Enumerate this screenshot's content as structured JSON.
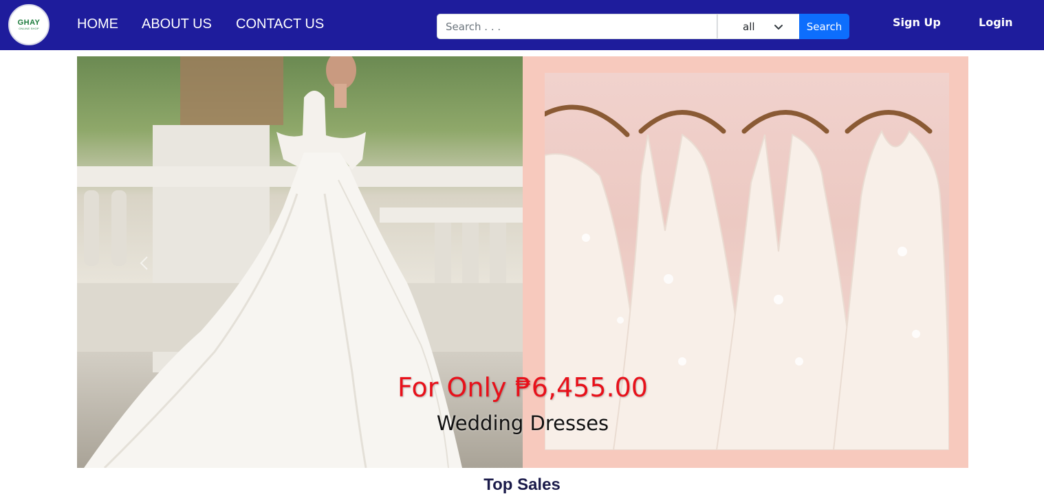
{
  "logo": {
    "main": "GHAY",
    "sub": "ONLINE SHOP"
  },
  "nav": {
    "home": "HOME",
    "about": "ABOUT US",
    "contact": "CONTACT US"
  },
  "search": {
    "placeholder": "Search . . .",
    "category_selected": "all",
    "button_label": "Search"
  },
  "auth": {
    "signup": "Sign Up",
    "login": "Login"
  },
  "hero": {
    "price_caption": "For Only ₱6,455.00",
    "title_caption": "Wedding Dresses"
  },
  "sections": {
    "top_sales": "Top Sales"
  },
  "colors": {
    "navbar": "#1e1c9c",
    "search_button": "#0d6efd",
    "price_caption": "#e8101a",
    "hero_right_bg": "#f7c9bd"
  }
}
